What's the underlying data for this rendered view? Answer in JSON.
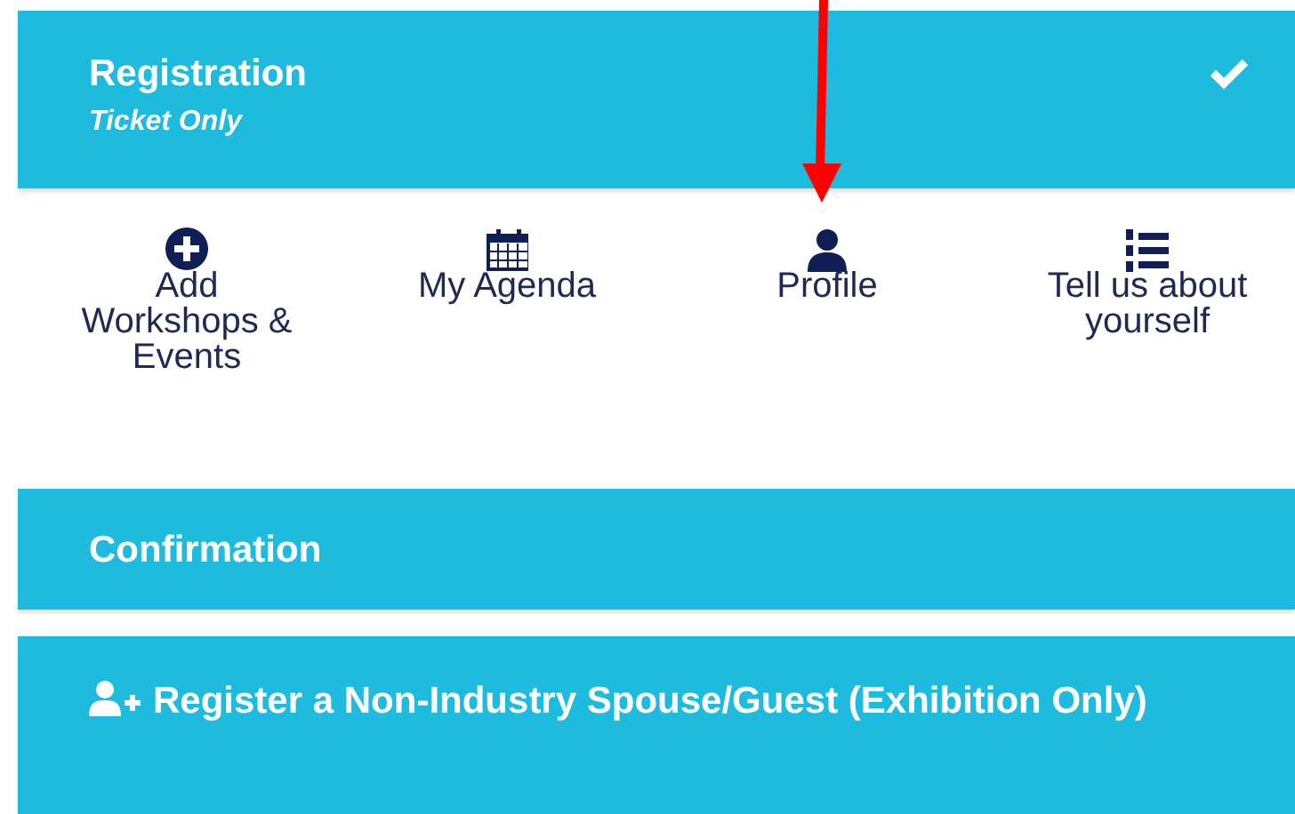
{
  "registration": {
    "title": "Registration",
    "subtitle": "Ticket Only",
    "completed": true
  },
  "menu": [
    {
      "kind": "add",
      "label": "Add Workshops & Events"
    },
    {
      "kind": "calendar",
      "label": "My Agenda"
    },
    {
      "kind": "user",
      "label": "Profile"
    },
    {
      "kind": "list",
      "label": "Tell us about yourself"
    }
  ],
  "sections": [
    {
      "kind": "plain",
      "title": "Confirmation"
    },
    {
      "kind": "guest",
      "title": "Register a Non-Industry Spouse/Guest (Exhibition Only)"
    }
  ],
  "annotation": {
    "kind": "arrow"
  }
}
